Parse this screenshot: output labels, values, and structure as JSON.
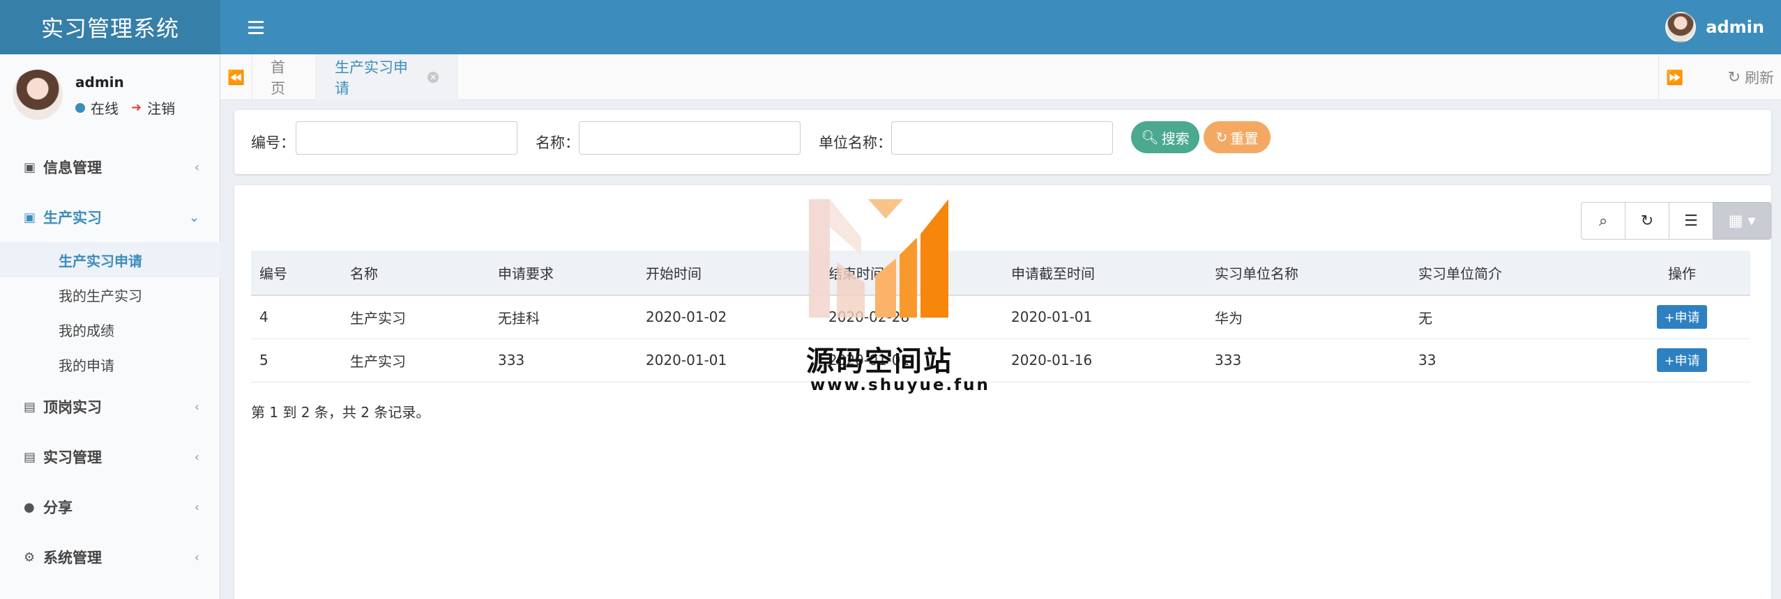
{
  "app": {
    "title": "实习管理系统"
  },
  "navbar": {
    "username": "admin"
  },
  "user_panel": {
    "name": "admin",
    "status": "在线",
    "logout": "注销"
  },
  "sidebar": {
    "items": [
      {
        "label": "信息管理",
        "icon": "id-badge-icon"
      },
      {
        "label": "生产实习",
        "icon": "user-square-icon",
        "expanded": true,
        "children": [
          "生产实习申请",
          "我的生产实习",
          "我的成绩",
          "我的申请"
        ]
      },
      {
        "label": "顶岗实习",
        "icon": "id-card-icon"
      },
      {
        "label": "实习管理",
        "icon": "id-card-icon"
      },
      {
        "label": "分享",
        "icon": "comment-icon"
      },
      {
        "label": "系统管理",
        "icon": "gear-icon"
      }
    ]
  },
  "tabs": {
    "home": "首页",
    "active": "生产实习申请",
    "refresh": "刷新"
  },
  "search": {
    "label_id": "编号：",
    "label_name": "名称：",
    "label_unit": "单位名称：",
    "value_id": "",
    "value_name": "",
    "value_unit": "",
    "search_btn": "搜索",
    "reset_btn": "重置"
  },
  "table": {
    "columns": [
      "编号",
      "名称",
      "申请要求",
      "开始时间",
      "结束时间",
      "申请截至时间",
      "实习单位名称",
      "实习单位简介",
      "操作"
    ],
    "rows": [
      [
        "4",
        "生产实习",
        "无挂科",
        "2020-01-02",
        "2020-02-28",
        "2020-01-01",
        "华为",
        "无"
      ],
      [
        "5",
        "生产实习",
        "333",
        "2020-01-01",
        "2020-01-01",
        "2020-01-16",
        "333",
        "33"
      ]
    ],
    "action_label": "+申请",
    "footer": "第 1 到 2 条，共 2 条记录。"
  },
  "watermark": {
    "name": "源码空间站",
    "url": "www.shuyue.fun"
  },
  "colors": {
    "header": "#3c8dbc",
    "logo": "#367fa9",
    "search": "#4aa98e",
    "reset": "#f3a963",
    "accent": "#3c8dbc"
  }
}
